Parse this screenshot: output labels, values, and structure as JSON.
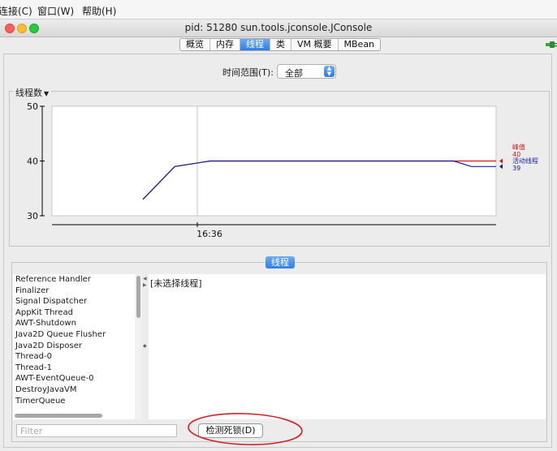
{
  "menu": {
    "items": [
      {
        "label": "连接(C)",
        "mnemonic": "C"
      },
      {
        "label": "窗口(W)",
        "mnemonic": "W"
      },
      {
        "label": "帮助(H)",
        "mnemonic": "H"
      }
    ]
  },
  "window": {
    "title": "pid: 51280 sun.tools.jconsole.JConsole"
  },
  "tabs": [
    {
      "label": "概览",
      "active": false
    },
    {
      "label": "内存",
      "active": false
    },
    {
      "label": "线程",
      "active": true
    },
    {
      "label": "类",
      "active": false
    },
    {
      "label": "VM 概要",
      "active": false
    },
    {
      "label": "MBean",
      "active": false
    }
  ],
  "time_range": {
    "label": "时间范围(T):",
    "value": "全部"
  },
  "chart": {
    "panel_title": "线程数",
    "accent_colors": {
      "peak": "#cc1b1b",
      "live": "#1b1b99",
      "grid": "#c8c8c8"
    }
  },
  "chart_data": {
    "type": "line",
    "ylim": [
      30,
      50
    ],
    "yticks": [
      30,
      40,
      50
    ],
    "xtick_labels": [
      "16:36"
    ],
    "series": [
      {
        "name": "峰值",
        "color": "#cc1b1b",
        "last_value": 40,
        "points": [
          [
            0.0,
            33
          ],
          [
            0.09,
            39
          ],
          [
            0.19,
            40
          ],
          [
            0.88,
            40
          ],
          [
            1.0,
            40
          ]
        ]
      },
      {
        "name": "活动线程",
        "color": "#1b1b99",
        "last_value": 39,
        "points": [
          [
            0.0,
            33
          ],
          [
            0.09,
            39
          ],
          [
            0.19,
            40
          ],
          [
            0.88,
            40
          ],
          [
            0.93,
            39
          ],
          [
            1.0,
            39
          ]
        ]
      }
    ],
    "legend": [
      {
        "name": "峰值",
        "value": "40",
        "color": "#cc1b1b"
      },
      {
        "name": "活动线程",
        "value": "39",
        "color": "#1b1b99"
      }
    ]
  },
  "threads_section": {
    "label": "线程",
    "list": [
      "Reference Handler",
      "Finalizer",
      "Signal Dispatcher",
      "AppKit Thread",
      "AWT-Shutdown",
      "Java2D Queue Flusher",
      "Java2D Disposer",
      "Thread-0",
      "Thread-1",
      "AWT-EventQueue-0",
      "DestroyJavaVM",
      "TimerQueue"
    ],
    "detail_text": "[未选择线程]",
    "filter_placeholder": "Filter",
    "detect_deadlock_button": "检测死锁(D)"
  }
}
